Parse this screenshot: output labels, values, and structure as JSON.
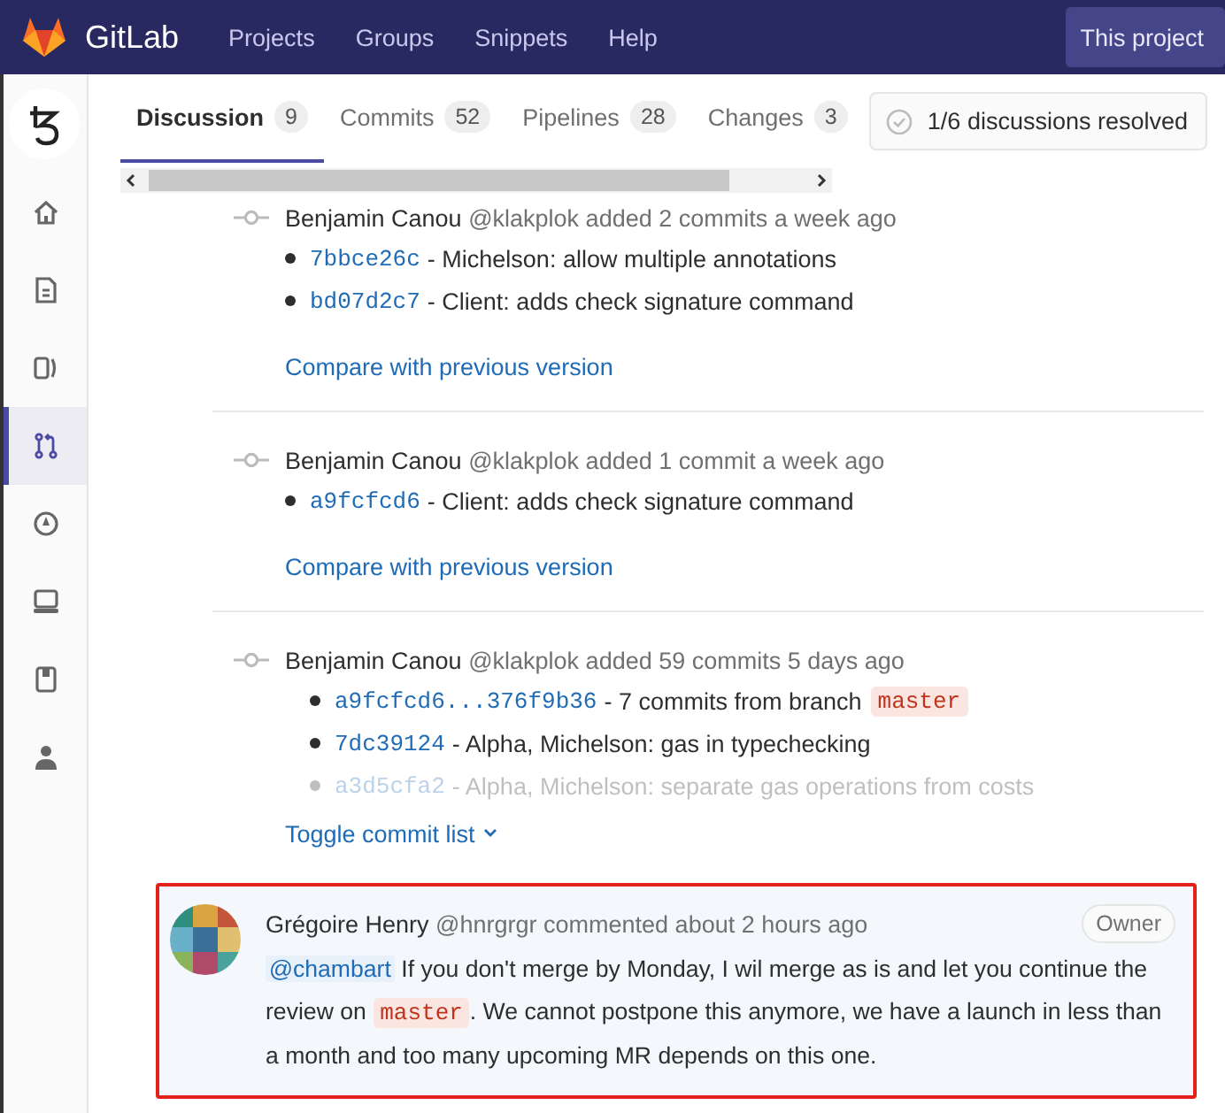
{
  "navbar": {
    "brand": "GitLab",
    "links": [
      "Projects",
      "Groups",
      "Snippets",
      "Help"
    ],
    "project_button": "This project"
  },
  "sidebar": {
    "items": [
      {
        "selected": false
      },
      {
        "selected": false
      },
      {
        "selected": false
      },
      {
        "selected": true
      },
      {
        "selected": false
      },
      {
        "selected": false
      },
      {
        "selected": false
      },
      {
        "selected": false
      }
    ]
  },
  "tabs": [
    {
      "label": "Discussion",
      "count": "9",
      "selected": true
    },
    {
      "label": "Commits",
      "count": "52",
      "selected": false
    },
    {
      "label": "Pipelines",
      "count": "28",
      "selected": false
    },
    {
      "label": "Changes",
      "count": "3",
      "selected": false
    }
  ],
  "resolved": {
    "text": "1/6 discussions resolved"
  },
  "events": [
    {
      "author": "Benjamin Canou",
      "meta": "@klakplok added 2 commits a week ago",
      "commits": [
        {
          "sha": "7bbce26c",
          "message": "- Michelson: allow multiple annotations",
          "faded": false
        },
        {
          "sha": "bd07d2c7",
          "message": "- Client: adds check signature command",
          "faded": false
        }
      ],
      "link": {
        "text": "Compare with previous version",
        "caret": false
      }
    },
    {
      "author": "Benjamin Canou",
      "meta": "@klakplok added 1 commit a week ago",
      "commits": [
        {
          "sha": "a9fcfcd6",
          "message": "- Client: adds check signature command",
          "faded": false
        }
      ],
      "link": {
        "text": "Compare with previous version",
        "caret": false
      }
    },
    {
      "author": "Benjamin Canou",
      "meta": "@klakplok added 59 commits 5 days ago",
      "commits": [
        {
          "sha": "a9fcfcd6...376f9b36",
          "message": "- 7 commits from branch",
          "branch": "master",
          "faded": false
        },
        {
          "sha": "7dc39124",
          "message": "- Alpha, Michelson: gas in typechecking",
          "faded": false
        },
        {
          "sha": "a3d5cfa2",
          "message": "- Alpha, Michelson: separate gas operations from costs",
          "faded": true
        }
      ],
      "link": {
        "text": "Toggle commit list",
        "caret": true
      }
    }
  ],
  "comment": {
    "author": "Grégoire Henry",
    "meta": "@hnrgrgr commented about 2 hours ago",
    "badge": "Owner",
    "highlighted": true,
    "body": [
      {
        "kind": "mention",
        "text": "@chambart"
      },
      {
        "kind": "text",
        "text": " If you don't merge by Monday, I wil merge as is and let you continue the review on "
      },
      {
        "kind": "code",
        "text": "master"
      },
      {
        "kind": "text",
        "text": ". We cannot postpone this anymore, we have a launch in less than a month and too many upcoming MR depends on this one."
      }
    ]
  }
}
